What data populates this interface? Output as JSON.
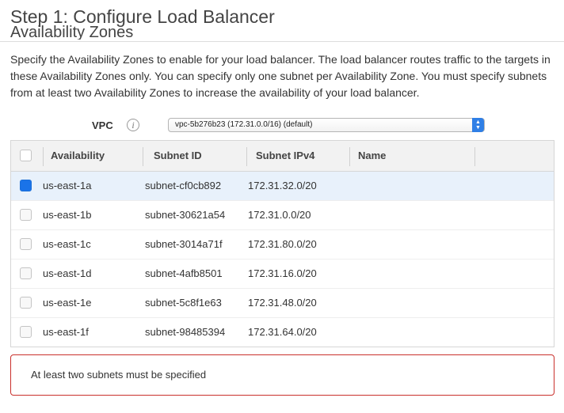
{
  "header": {
    "step_title": "Step 1: Configure Load Balancer",
    "section_title": "Availability Zones",
    "description": "Specify the Availability Zones to enable for your load balancer. The load balancer routes traffic to the targets in these Availability Zones only. You can specify only one subnet per Availability Zone. You must specify subnets from at least two Availability Zones to increase the availability of your load balancer."
  },
  "vpc": {
    "label": "VPC",
    "info_icon": "info-icon",
    "selected_value": "vpc-5b276b23 (172.31.0.0/16) (default)"
  },
  "table": {
    "columns": [
      "Availability",
      "Subnet ID",
      "Subnet IPv4",
      "Name"
    ],
    "rows": [
      {
        "zone": "us-east-1a",
        "subnet_id": "subnet-cf0cb892",
        "ipv4": "172.31.32.0/20",
        "name": "",
        "checked": true
      },
      {
        "zone": "us-east-1b",
        "subnet_id": "subnet-30621a54",
        "ipv4": "172.31.0.0/20",
        "name": "",
        "checked": false
      },
      {
        "zone": "us-east-1c",
        "subnet_id": "subnet-3014a71f",
        "ipv4": "172.31.80.0/20",
        "name": "",
        "checked": false
      },
      {
        "zone": "us-east-1d",
        "subnet_id": "subnet-4afb8501",
        "ipv4": "172.31.16.0/20",
        "name": "",
        "checked": false
      },
      {
        "zone": "us-east-1e",
        "subnet_id": "subnet-5c8f1e63",
        "ipv4": "172.31.48.0/20",
        "name": "",
        "checked": false
      },
      {
        "zone": "us-east-1f",
        "subnet_id": "subnet-98485394",
        "ipv4": "172.31.64.0/20",
        "name": "",
        "checked": false
      }
    ]
  },
  "error": {
    "message": "At least two subnets must be specified"
  },
  "colors": {
    "accent": "#1a73e8",
    "selected_row": "#e8f1fb",
    "error_border": "#c9302c",
    "header_bg": "#f2f2f2"
  }
}
